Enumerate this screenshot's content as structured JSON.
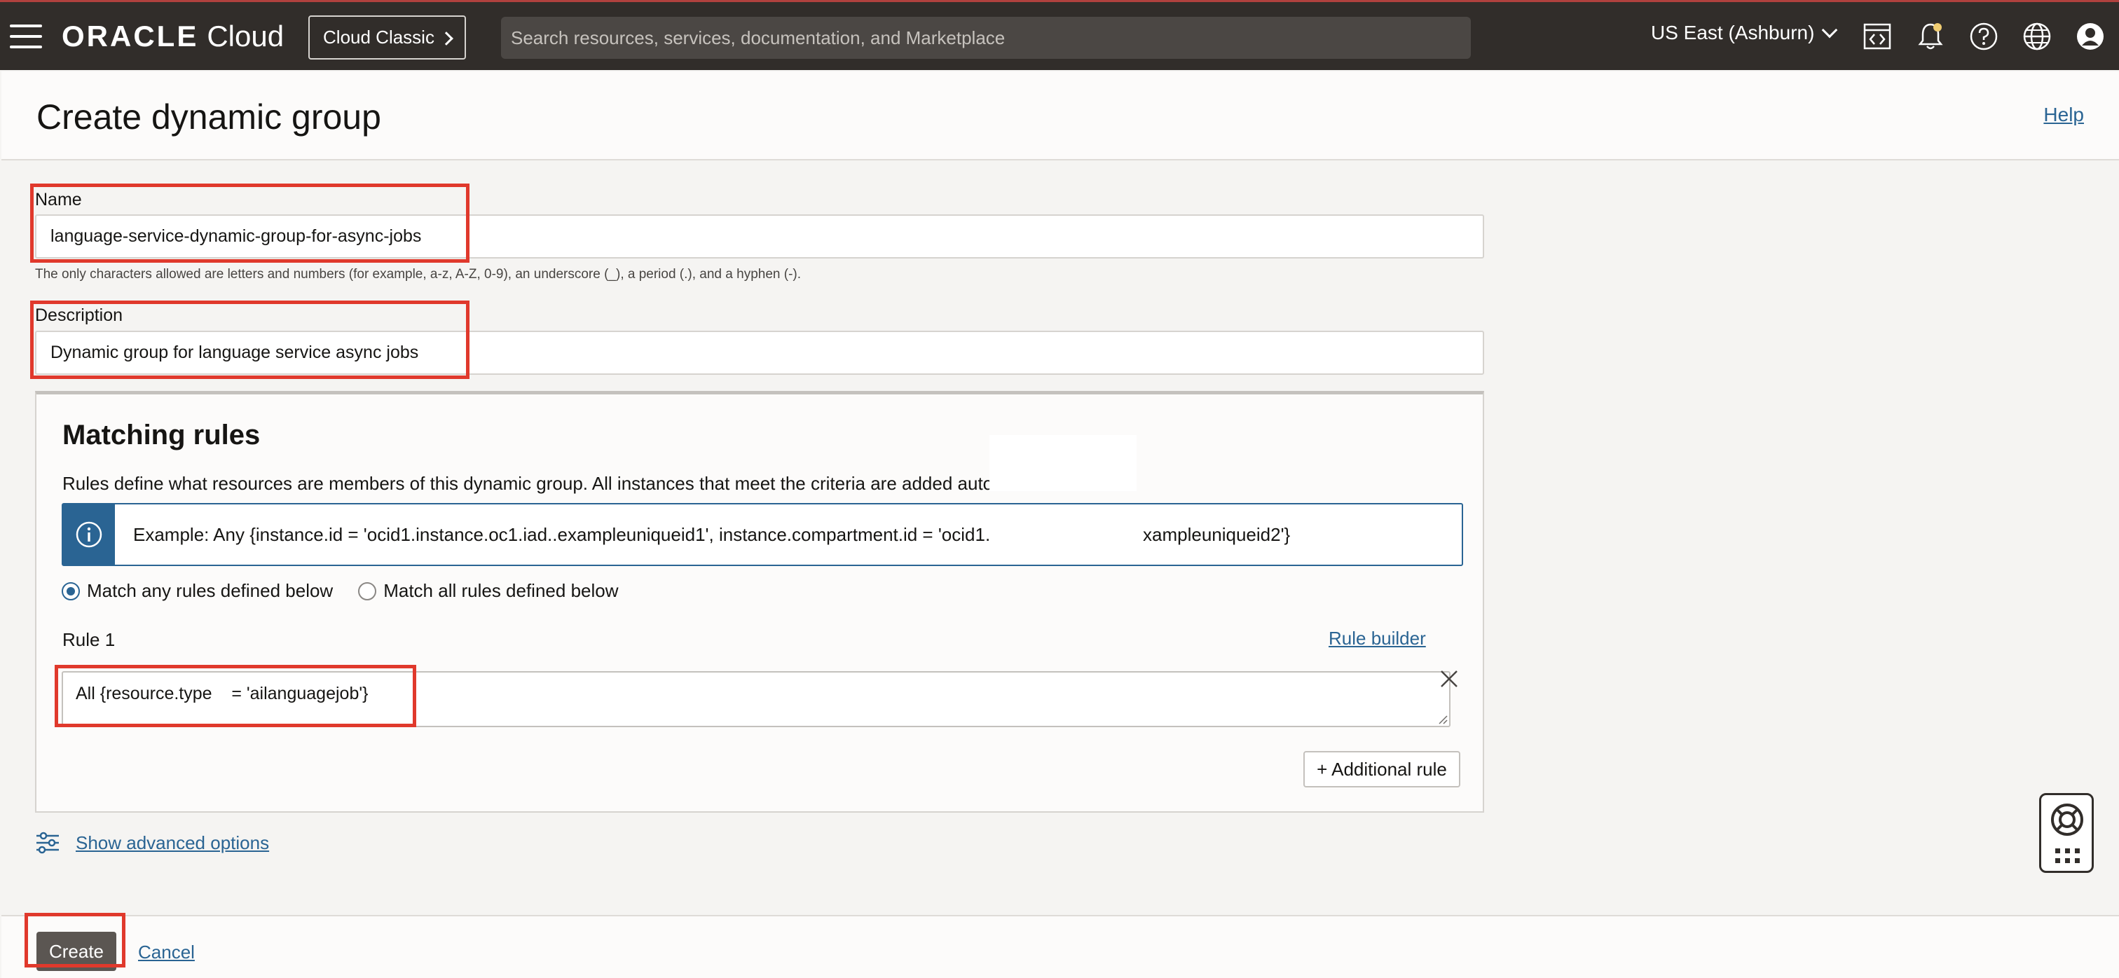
{
  "topbar": {
    "brand_oracle": "ORACLE",
    "brand_cloud": "Cloud",
    "classic_label": "Cloud Classic",
    "search_placeholder": "Search resources, services, documentation, and Marketplace",
    "region": "US East (Ashburn)",
    "icons": [
      "menu-icon",
      "code-editor-icon",
      "bell-icon",
      "help-icon",
      "globe-icon",
      "user-icon"
    ],
    "accent_color": "#b0413e",
    "notification_dot_color": "#f0cc71"
  },
  "header": {
    "title": "Create dynamic group",
    "help_label": "Help"
  },
  "form": {
    "name_label": "Name",
    "name_value": "language-service-dynamic-group-for-async-jobs",
    "name_hint": "The only characters allowed are letters and numbers (for example, a-z, A-Z, 0-9), an underscore (_), a period (.), and a hyphen (-).",
    "description_label": "Description",
    "description_value": "Dynamic group for language service async jobs"
  },
  "matching_rules": {
    "title": "Matching rules",
    "description": "Rules define what resources are members of this dynamic group. All instances that meet the criteria are added autom",
    "example_left": "Example: Any {instance.id = 'ocid1.instance.oc1.iad..exampleuniqueid1', instance.compartment.id = 'ocid1.co",
    "example_right": "xampleuniqueid2'}",
    "match_any_label": "Match any rules defined below",
    "match_all_label": "Match all rules defined below",
    "selected_option": "any",
    "rule_label": "Rule 1",
    "rule_builder_label": "Rule builder",
    "rule_value": "All {resource.type    = 'ailanguagejob'}",
    "additional_rule_label": "+ Additional rule"
  },
  "advanced_options_label": "Show advanced options",
  "footer": {
    "create_label": "Create",
    "cancel_label": "Cancel"
  },
  "highlight_color": "#e0392c",
  "link_color": "#2a6493"
}
